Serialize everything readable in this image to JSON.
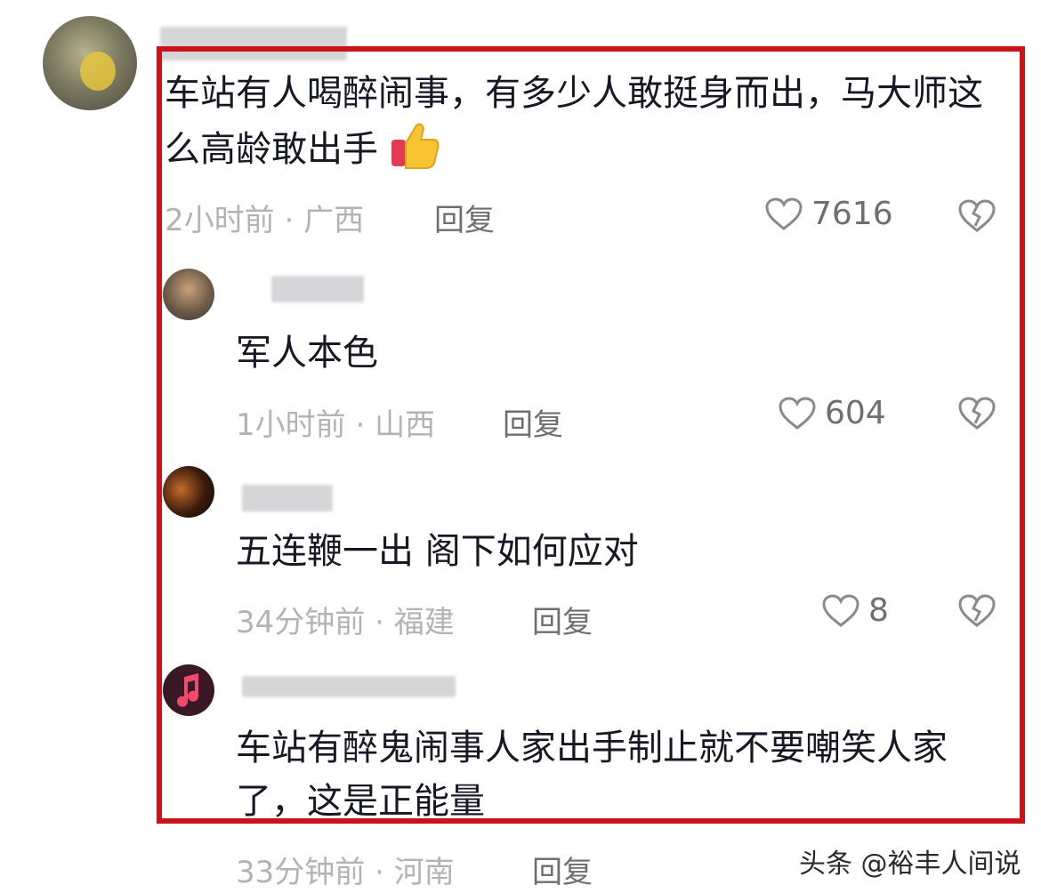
{
  "comments": [
    {
      "text": "车站有人喝醉闹事，有多少人敢挺身而出，马大师这么高龄敢出手",
      "emoji_icon": "thumbs-up-emoji",
      "time": "2小时前",
      "location": "广西",
      "reply_label": "回复",
      "likes": "7616"
    },
    {
      "text": "军人本色",
      "time": "1小时前",
      "location": "山西",
      "reply_label": "回复",
      "likes": "604"
    },
    {
      "text": "五连鞭一出 阁下如何应对",
      "time": "34分钟前",
      "location": "福建",
      "reply_label": "回复",
      "likes": "8"
    },
    {
      "text": "车站有醉鬼闹事人家出手制止就不要嘲笑人家了，这是正能量",
      "time": "33分钟前",
      "location": "河南",
      "reply_label": "回复"
    }
  ],
  "separator": " · ",
  "watermark": "头条 @裕丰人间说",
  "colors": {
    "highlight_box": "#c8141a",
    "meta_text": "#b3b3b6",
    "body_text": "#161823"
  },
  "icons": [
    "heart-outline-icon",
    "dislike-broken-heart-icon",
    "tiktok-logo-icon",
    "music-note-icon"
  ]
}
